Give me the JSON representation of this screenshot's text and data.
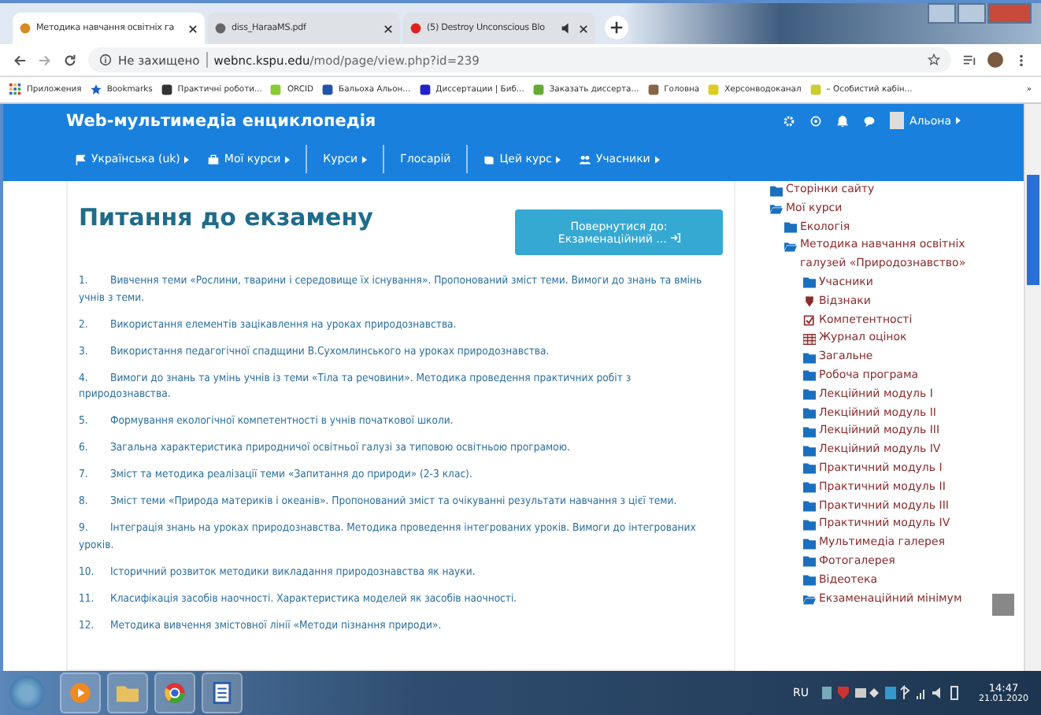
{
  "browser": {
    "tabs": [
      {
        "title": "Методика навчання освітніх га",
        "selected": true,
        "audio": false
      },
      {
        "title": "diss_HaraaMS.pdf",
        "selected": false,
        "audio": false
      },
      {
        "title": "(5) Destroy Unconscious Blo",
        "selected": false,
        "audio": true
      }
    ],
    "security": "Не захищено",
    "url_host": "webnc.kspu.edu",
    "url_path": "/mod/page/view.php?id=239",
    "bookmarks": [
      "Приложения",
      "Bookmarks",
      "Практичні роботи...",
      "ORCID",
      "Бальоха Альон...",
      "Диссертации | Биб...",
      "Заказать диссерта...",
      "Головна",
      "Херсонводоканал",
      "– Особистий кабін..."
    ],
    "bookmarks_more": "»"
  },
  "site": {
    "title": "Web-мультимедіа енциклопедія",
    "user": "Альона",
    "menu": [
      "Українська (uk)",
      "Мої курси",
      "Курси",
      "Глосарій",
      "Цей курс",
      "Учасники"
    ]
  },
  "page": {
    "heading": "Питання до екзамену",
    "back_button": "Повернутися до: Екзаменаційний ...",
    "questions": [
      {
        "number": "1.",
        "text": "Вивчення теми «Рослини, тварини і середовище їх існування». Пропонований зміст теми. Вимоги до знань та вмінь учнів з теми."
      },
      {
        "number": "2.",
        "text": "Використання елементів зацікавлення на уроках природознавства."
      },
      {
        "number": "3.",
        "text": "Використання педагогічної спадщини В.Сухомлинського на уроках природознавства."
      },
      {
        "number": "4.",
        "text": "Вимоги до знань та умінь учнів із теми «Тіла та речовини». Методика проведення практичних робіт з природознавства."
      },
      {
        "number": "5.",
        "text": "Формування екологічної компетентності в учнів початкової школи."
      },
      {
        "number": "6.",
        "text": "Загальна характеристика природничої освітньої галузі за типовою освітньою програмою."
      },
      {
        "number": "7.",
        "text": "Зміст та методика реалізації теми «Запитання до природи» (2-3 клас)."
      },
      {
        "number": "8.",
        "text": "Зміст теми «Природа материків і океанів». Пропонований зміст та очікуванні результати навчання з цієї теми."
      },
      {
        "number": "9.",
        "text": "Інтеграція знань на уроках природознавства. Методика проведення інтегрованих уроків. Вимоги до інтегрованих уроків."
      },
      {
        "number": "10.",
        "text": "Історичний розвиток методики викладання природознавства як науки."
      },
      {
        "number": "11.",
        "text": "Класифікація засобів наочності. Характеристика моделей як засобів наочності."
      },
      {
        "number": "12.",
        "text": "Методика вивчення змістовної лінії «Методи пізнання природи»."
      }
    ]
  },
  "sidebar": {
    "items": [
      {
        "label": "Сторінки сайту",
        "kind": "folder",
        "expanded": false
      },
      {
        "label": "Мої курси",
        "kind": "folder",
        "expanded": true,
        "children": [
          {
            "label": "Екологія",
            "kind": "folder",
            "expanded": false
          },
          {
            "label": "Методика навчання освітніх галузей «Природознавство»",
            "kind": "folder",
            "expanded": true,
            "children": [
              {
                "label": "Учасники",
                "kind": "folder",
                "expanded": false
              },
              {
                "label": "Відзнаки",
                "kind": "badge"
              },
              {
                "label": "Компетентності",
                "kind": "check"
              },
              {
                "label": "Журнал оцінок",
                "kind": "table"
              },
              {
                "label": "Загальне",
                "kind": "folder",
                "expanded": false
              },
              {
                "label": "Робоча програма",
                "kind": "folder",
                "expanded": false
              },
              {
                "label": "Лекційний модуль I",
                "kind": "folder",
                "expanded": false
              },
              {
                "label": "Лекційний модуль II",
                "kind": "folder",
                "expanded": false
              },
              {
                "label": "Лекційний модуль III",
                "kind": "folder",
                "expanded": false
              },
              {
                "label": "Лекційний модуль IV",
                "kind": "folder",
                "expanded": false
              },
              {
                "label": "Практичний модуль I",
                "kind": "folder",
                "expanded": false
              },
              {
                "label": "Практичний модуль II",
                "kind": "folder",
                "expanded": false
              },
              {
                "label": "Практичний модуль III",
                "kind": "folder",
                "expanded": false
              },
              {
                "label": "Практичний модуль IV",
                "kind": "folder",
                "expanded": false
              },
              {
                "label": "Мультимедіа галерея",
                "kind": "folder",
                "expanded": false
              },
              {
                "label": "Фотогалерея",
                "kind": "folder",
                "expanded": false
              },
              {
                "label": "Відеотека",
                "kind": "folder",
                "expanded": false
              },
              {
                "label": "Екзаменаційний мінімум",
                "kind": "folder",
                "expanded": true
              }
            ]
          }
        ]
      }
    ]
  },
  "taskbar": {
    "language": "RU",
    "time": "14:47",
    "date": "21.01.2020"
  }
}
